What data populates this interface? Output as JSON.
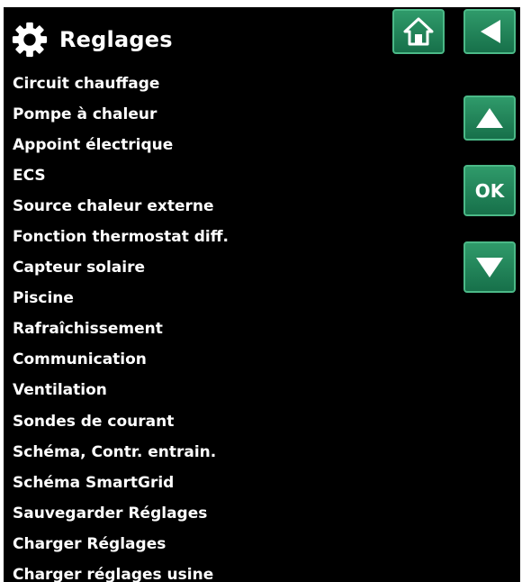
{
  "header": {
    "title": "Reglages",
    "icon": "gear-icon"
  },
  "menu": {
    "items": [
      {
        "label": "Circuit chauffage"
      },
      {
        "label": "Pompe à chaleur"
      },
      {
        "label": "Appoint électrique"
      },
      {
        "label": "ECS"
      },
      {
        "label": "Source chaleur externe"
      },
      {
        "label": "Fonction thermostat diff."
      },
      {
        "label": "Capteur solaire"
      },
      {
        "label": "Piscine"
      },
      {
        "label": "Rafraîchissement"
      },
      {
        "label": "Communication"
      },
      {
        "label": "Ventilation"
      },
      {
        "label": "Sondes de courant"
      },
      {
        "label": "Schéma, Contr. entrain."
      },
      {
        "label": "Schéma SmartGrid"
      },
      {
        "label": "Sauvegarder Réglages"
      },
      {
        "label": "Charger Réglages"
      },
      {
        "label": "Charger réglages usine"
      }
    ]
  },
  "buttons": {
    "home_icon": "home-icon",
    "back_icon": "back-arrow-icon",
    "up_icon": "arrow-up-icon",
    "ok_label": "OK",
    "down_icon": "arrow-down-icon"
  },
  "colors": {
    "background": "#000000",
    "text": "#ffffff",
    "button_top": "#2f9a6a",
    "button_bottom": "#17704a",
    "button_border": "#4bb987"
  }
}
